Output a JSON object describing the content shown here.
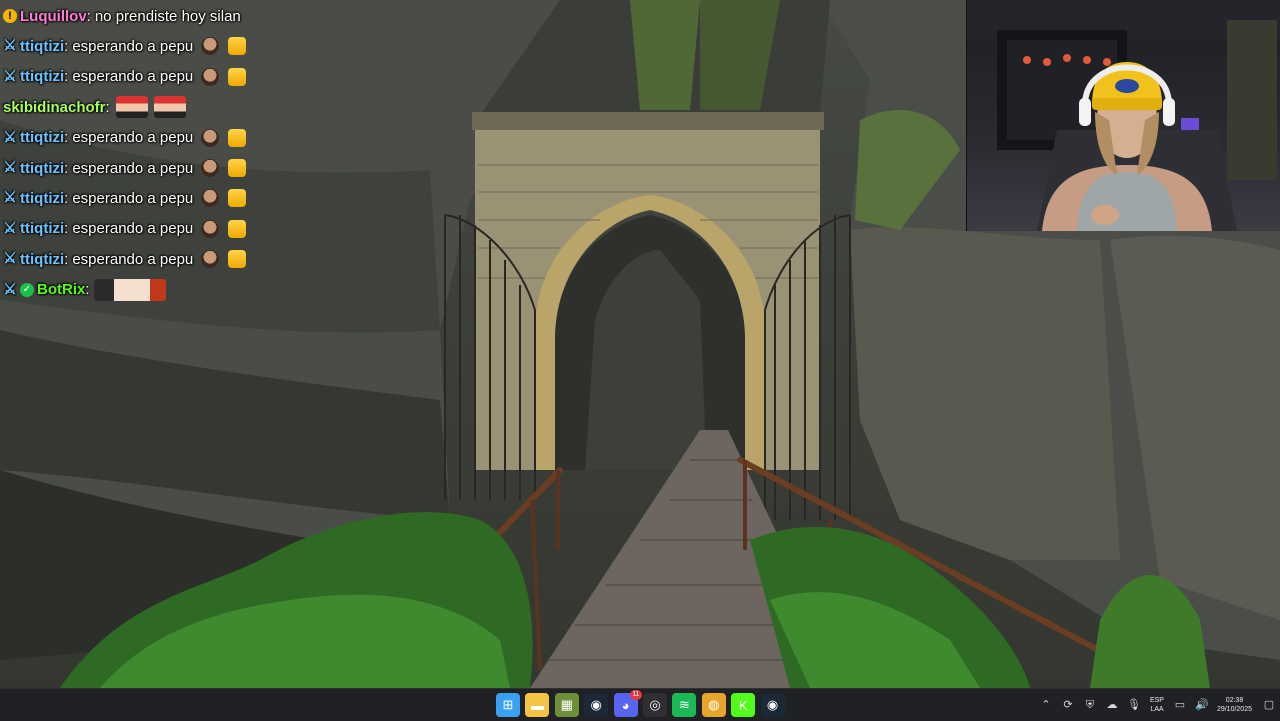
{
  "chat": {
    "messages": [
      {
        "user": "Luquillov",
        "text": "no prendiste hoy silan",
        "user_color": "#ff7bd5",
        "badge": "warn-icon",
        "emotes": []
      },
      {
        "user": "ttiqtizi",
        "text": "esperando a pepu",
        "user_color": "#6ec3ff",
        "badge": "sword-icon",
        "emotes": [
          "face",
          "thumb"
        ]
      },
      {
        "user": "ttiqtizi",
        "text": "esperando a pepu",
        "user_color": "#6ec3ff",
        "badge": "sword-icon",
        "emotes": [
          "face",
          "thumb"
        ]
      },
      {
        "user": "skibidinachofr",
        "text": "",
        "user_color": "#a8ff60",
        "badge": "",
        "emotes": [
          "big",
          "big"
        ]
      },
      {
        "user": "ttiqtizi",
        "text": "esperando a pepu",
        "user_color": "#6ec3ff",
        "badge": "sword-icon",
        "emotes": [
          "face",
          "thumb"
        ]
      },
      {
        "user": "ttiqtizi",
        "text": "esperando a pepu",
        "user_color": "#6ec3ff",
        "badge": "sword-icon",
        "emotes": [
          "face",
          "thumb"
        ]
      },
      {
        "user": "ttiqtizi",
        "text": "esperando a pepu",
        "user_color": "#6ec3ff",
        "badge": "sword-icon",
        "emotes": [
          "face",
          "thumb"
        ]
      },
      {
        "user": "ttiqtizi",
        "text": "esperando a pepu",
        "user_color": "#6ec3ff",
        "badge": "sword-icon",
        "emotes": [
          "face",
          "thumb"
        ]
      },
      {
        "user": "ttiqtizi",
        "text": "esperando a pepu",
        "user_color": "#6ec3ff",
        "badge": "sword-icon",
        "emotes": [
          "face",
          "thumb"
        ]
      },
      {
        "user": "BotRix",
        "text": "",
        "user_color": "#53fc18",
        "badge": "sword-icon",
        "extra_badge": "verified-check-icon",
        "emotes": [
          "wide"
        ]
      }
    ]
  },
  "taskbar": {
    "apps": [
      {
        "name": "windows-start",
        "icon": "windows-logo-icon",
        "color": "#3aa0f3"
      },
      {
        "name": "file-explorer",
        "icon": "folder-icon",
        "color": "#f4c542"
      },
      {
        "name": "minecraft",
        "icon": "grass-block-icon",
        "color": "#6b8f3a"
      },
      {
        "name": "steam",
        "icon": "steam-icon",
        "color": "#1b2838"
      },
      {
        "name": "discord",
        "icon": "discord-icon",
        "color": "#5865f2",
        "notification_count": "11"
      },
      {
        "name": "obs",
        "icon": "obs-icon",
        "color": "#302e31"
      },
      {
        "name": "spotify",
        "icon": "spotify-icon",
        "color": "#1db954"
      },
      {
        "name": "chrome",
        "icon": "chrome-icon",
        "color": "#e7a52b"
      },
      {
        "name": "kick",
        "icon": "kick-icon",
        "color": "#53fc18"
      },
      {
        "name": "steam-2",
        "icon": "steam-icon",
        "color": "#1b2838"
      }
    ],
    "tray": {
      "language_line1": "ESP",
      "language_line2": "LAA",
      "time": "02:38",
      "date": "29/10/2025"
    }
  }
}
